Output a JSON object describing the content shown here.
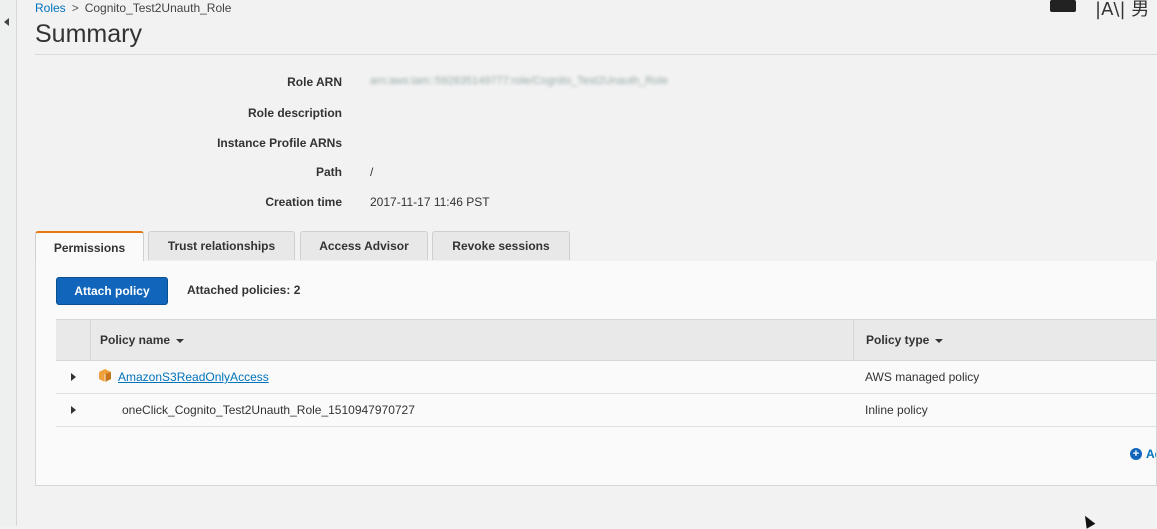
{
  "breadcrumb": {
    "roles_link": "Roles",
    "separator": ">",
    "current": "Cognito_Test2Unauth_Role"
  },
  "page_title": "Summary",
  "top_right": {
    "text": "|A\\| 男"
  },
  "summary": {
    "role_arn_label": "Role ARN",
    "role_arn_value": "arn:aws:iam::592835149777:role/Cognito_Test2Unauth_Role",
    "role_description_label": "Role description",
    "instance_profile_label": "Instance Profile ARNs",
    "path_label": "Path",
    "path_value": "/",
    "creation_time_label": "Creation time",
    "creation_time_value": "2017-11-17 11:46 PST"
  },
  "tabs": [
    {
      "label": "Permissions",
      "active": true
    },
    {
      "label": "Trust relationships",
      "active": false
    },
    {
      "label": "Access Advisor",
      "active": false
    },
    {
      "label": "Revoke sessions",
      "active": false
    }
  ],
  "permissions": {
    "attach_button": "Attach policy",
    "attached_count": "Attached policies: 2",
    "columns": {
      "policy_name": "Policy name",
      "policy_type": "Policy type"
    },
    "rows": [
      {
        "name": "AmazonS3ReadOnlyAccess",
        "type": "AWS managed policy",
        "is_link": true,
        "icon": "aws-managed-policy-icon"
      },
      {
        "name": "oneClick_Cognito_Test2Unauth_Role_1510947970727",
        "type": "Inline policy",
        "is_link": false
      }
    ],
    "add_inline_text": "Add inline policy"
  },
  "colors": {
    "primary_button": "#1166bb",
    "link": "#0073bb",
    "active_tab_accent": "#e47911",
    "policy_icon": "#f0a13b"
  }
}
